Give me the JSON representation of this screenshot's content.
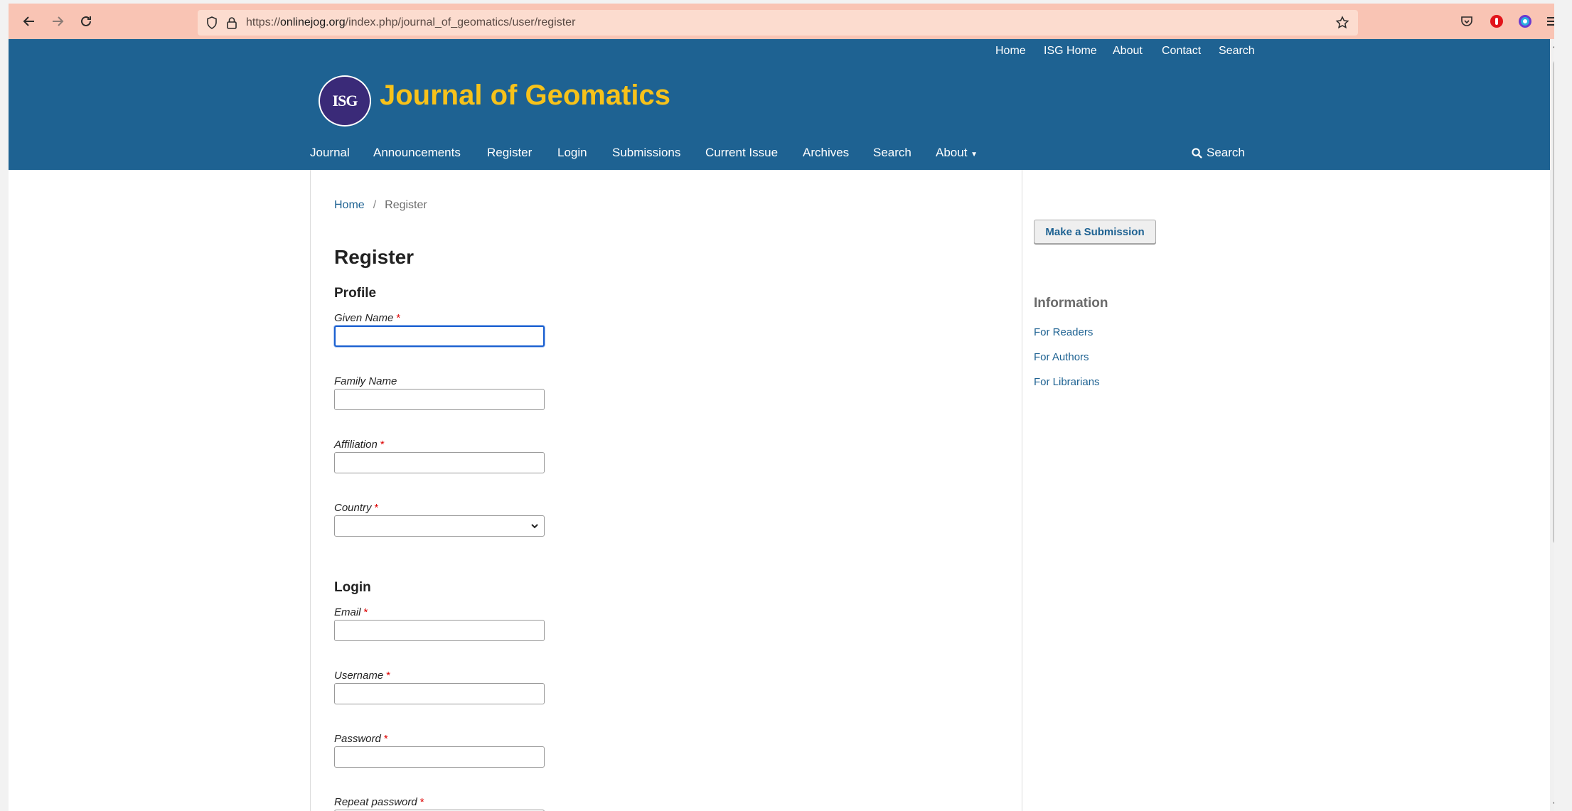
{
  "browser": {
    "url_prefix": "https://",
    "url_host": "onlinejog.org",
    "url_path": "/index.php/journal_of_geomatics/user/register",
    "icons": [
      "back-arrow-icon",
      "forward-arrow-icon",
      "reload-icon",
      "shield-icon",
      "lock-icon",
      "star-icon",
      "pocket-icon",
      "extension-icon",
      "color-extension-icon",
      "menu-icon"
    ]
  },
  "top_nav": [
    "Home",
    "ISG Home",
    "About",
    "Contact",
    "Search"
  ],
  "site": {
    "logo_text": "ISG",
    "title": "Journal of Geomatics"
  },
  "main_nav": [
    "Journal",
    "Announcements",
    "Register",
    "Login",
    "Submissions",
    "Current Issue",
    "Archives",
    "Search",
    "About"
  ],
  "search_label": "Search",
  "breadcrumb": {
    "home": "Home",
    "separator": "/",
    "current": "Register"
  },
  "page_title": "Register",
  "profile": {
    "heading": "Profile",
    "fields": [
      {
        "label": "Given Name",
        "required": "*"
      },
      {
        "label": "Family Name"
      },
      {
        "label": "Affiliation",
        "required": "*"
      },
      {
        "label": "Country",
        "required": "*",
        "value": ""
      }
    ]
  },
  "login": {
    "heading": "Login",
    "fields": [
      {
        "label": "Email",
        "required": "*"
      },
      {
        "label": "Username",
        "required": "*"
      },
      {
        "label": "Password",
        "required": "*"
      },
      {
        "label": "Repeat password",
        "required": "*"
      }
    ]
  },
  "sidebar": {
    "submit_button": "Make a Submission",
    "info_title": "Information",
    "links": [
      "For Readers",
      "For Authors",
      "For Librarians"
    ]
  },
  "colors": {
    "header_bg": "#1e6292",
    "title_yellow": "#f7c21a",
    "link": "#1e6292",
    "toolbar": "#f9c4b4"
  }
}
